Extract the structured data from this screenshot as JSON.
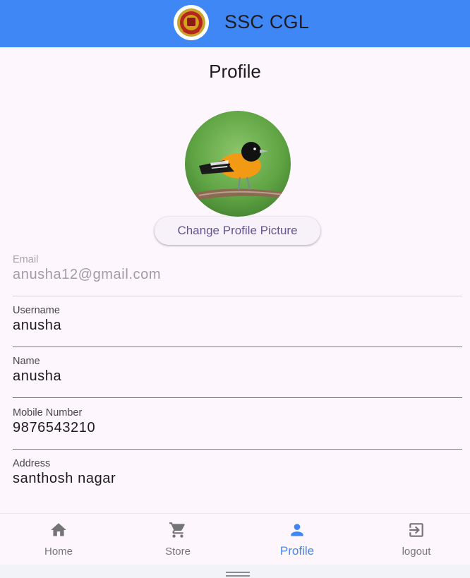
{
  "app": {
    "title": "SSC CGL",
    "logo_icon": "ssc-emblem-icon"
  },
  "page": {
    "title": "Profile"
  },
  "profile": {
    "avatar_icon": "bird-avatar-image",
    "change_picture_label": "Change Profile Picture"
  },
  "fields": {
    "email": {
      "label": "Email",
      "value": "anusha12@gmail.com",
      "disabled": true
    },
    "username": {
      "label": "Username",
      "value": "anusha"
    },
    "name": {
      "label": "Name",
      "value": "anusha"
    },
    "mobile": {
      "label": "Mobile Number",
      "value": "9876543210"
    },
    "address": {
      "label": "Address",
      "value": "santhosh nagar"
    }
  },
  "nav": {
    "items": [
      {
        "label": "Home",
        "icon": "home-icon",
        "active": false
      },
      {
        "label": "Store",
        "icon": "cart-icon",
        "active": false
      },
      {
        "label": "Profile",
        "icon": "person-icon",
        "active": true
      },
      {
        "label": "logout",
        "icon": "logout-icon",
        "active": false
      }
    ]
  },
  "colors": {
    "primary": "#3f87f5",
    "background": "#fdf7fd",
    "button_text": "#65558f",
    "inactive_nav": "#757575"
  }
}
